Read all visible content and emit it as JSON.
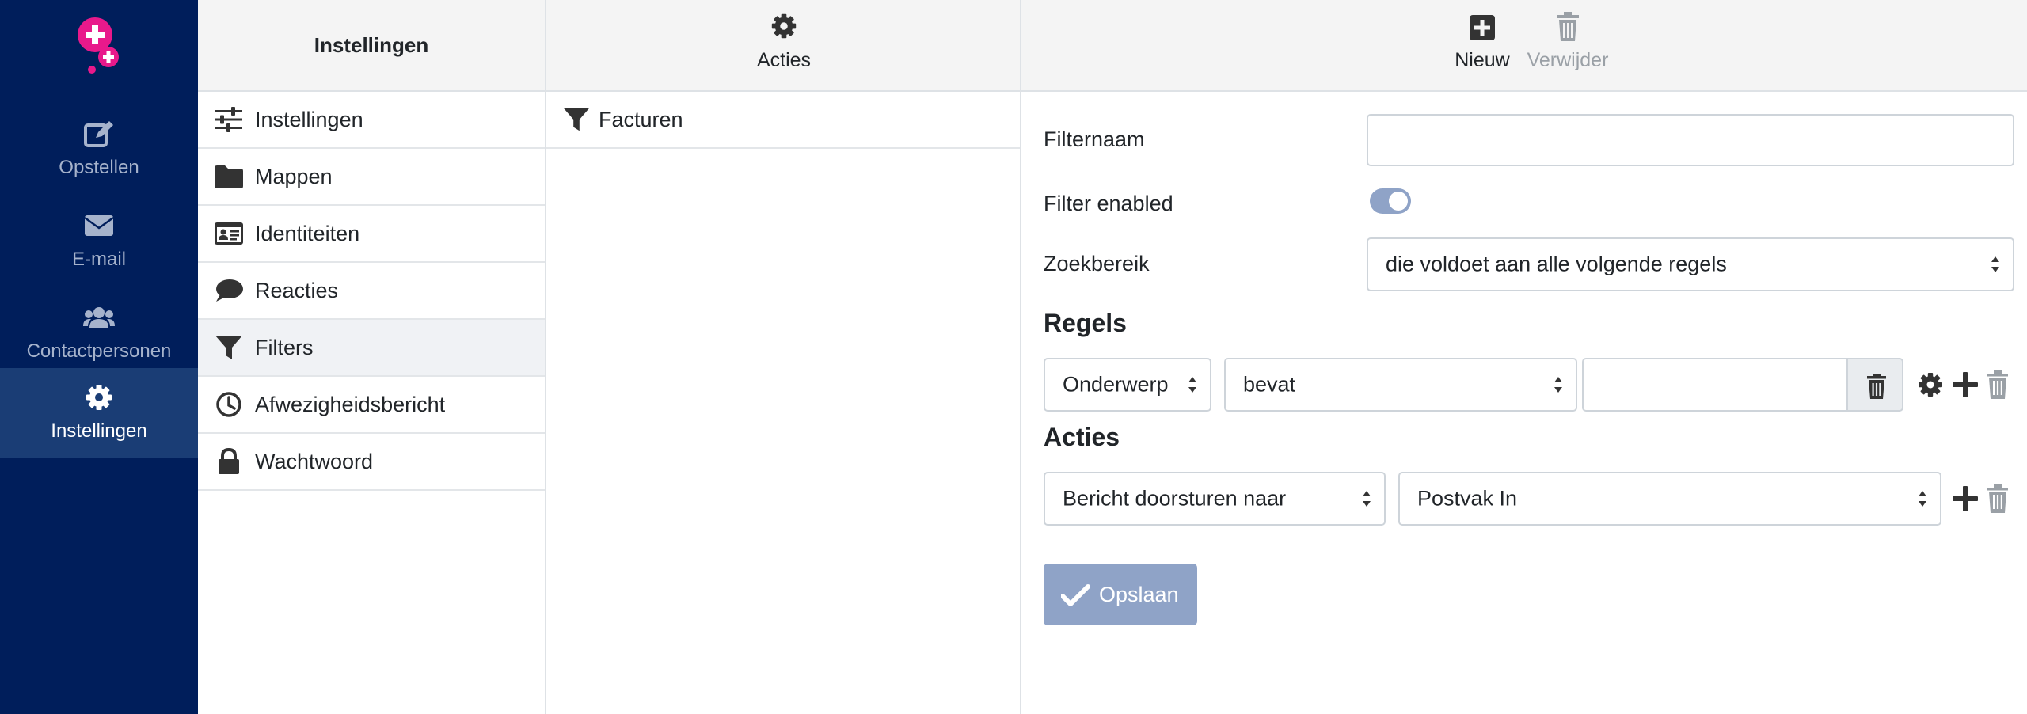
{
  "nav": {
    "items": [
      {
        "label": "Opstellen",
        "icon": "compose-icon"
      },
      {
        "label": "E-mail",
        "icon": "envelope-icon"
      },
      {
        "label": "Contactpersonen",
        "icon": "users-icon"
      },
      {
        "label": "Instellingen",
        "icon": "gear-icon",
        "active": true
      }
    ]
  },
  "settings": {
    "title": "Instellingen",
    "items": [
      {
        "label": "Instellingen",
        "icon": "sliders-icon"
      },
      {
        "label": "Mappen",
        "icon": "folder-icon"
      },
      {
        "label": "Identiteiten",
        "icon": "id-card-icon"
      },
      {
        "label": "Reacties",
        "icon": "comment-icon"
      },
      {
        "label": "Filters",
        "icon": "filter-icon",
        "active": true
      },
      {
        "label": "Afwezigheidsbericht",
        "icon": "clock-icon"
      },
      {
        "label": "Wachtwoord",
        "icon": "lock-icon"
      }
    ]
  },
  "filter_sets": {
    "actions_label": "Acties",
    "items": [
      {
        "label": "Facturen",
        "icon": "filter-icon"
      }
    ]
  },
  "toolbar": {
    "new_label": "Nieuw",
    "delete_label": "Verwijder"
  },
  "form": {
    "name_label": "Filternaam",
    "name_value": "",
    "enabled_label": "Filter enabled",
    "enabled": true,
    "scope_label": "Zoekbereik",
    "scope_value": "die voldoet aan alle volgende regels",
    "rules_title": "Regels",
    "rule": {
      "header": "Onderwerp",
      "operator": "bevat",
      "value": ""
    },
    "actions_title": "Acties",
    "action": {
      "type": "Bericht doorsturen naar",
      "target": "Postvak In"
    },
    "save_label": "Opslaan"
  },
  "colors": {
    "nav_bg": "#001e5b",
    "nav_active": "#1a3d75",
    "accent": "#8fa3c7",
    "logo": "#e8198b"
  }
}
